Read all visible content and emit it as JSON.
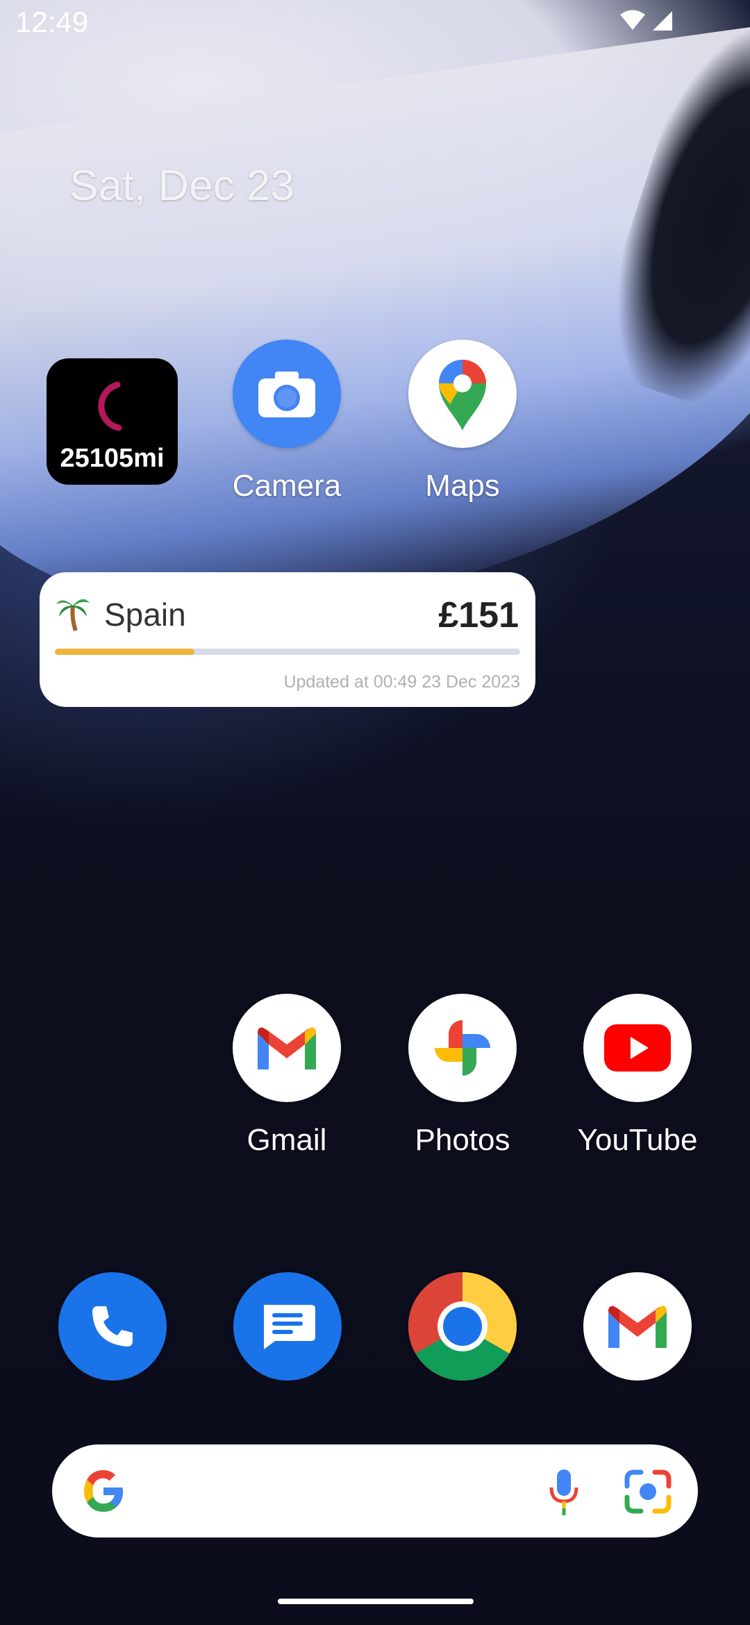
{
  "status_bar": {
    "time": "12:49"
  },
  "date": "Sat, Dec 23",
  "distance_widget": {
    "value": "25105mi"
  },
  "apps_row1": [
    {
      "label": "Camera"
    },
    {
      "label": "Maps"
    }
  ],
  "trip_widget": {
    "destination": "Spain",
    "amount": "£151",
    "progress": 0.3,
    "updated": "Updated at 00:49 23 Dec 2023"
  },
  "apps_row2": [
    {
      "label": "Gmail"
    },
    {
      "label": "Photos"
    },
    {
      "label": "YouTube"
    }
  ],
  "dock": [
    "phone-icon",
    "messages-icon",
    "chrome-icon",
    "gmail-icon"
  ],
  "colors": {
    "accent_google_blue": "#4285F4",
    "accent_google_red": "#EA4335",
    "accent_google_yellow": "#FBBC05",
    "accent_google_green": "#34A853",
    "progress_fill": "#f0b43a"
  }
}
